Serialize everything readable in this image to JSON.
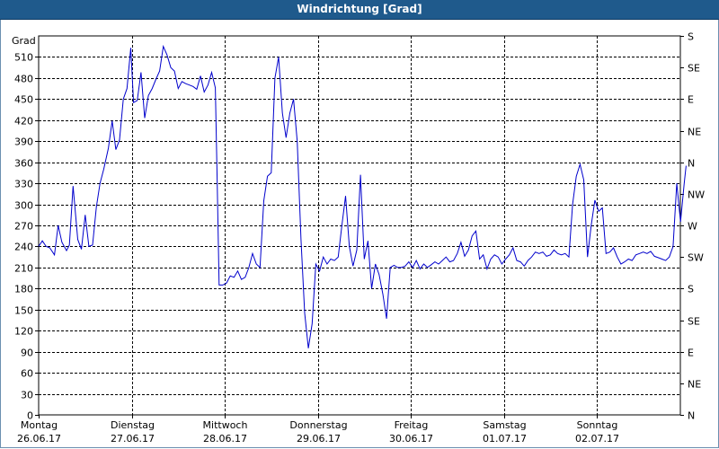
{
  "window": {
    "title": "Windrichtung [Grad]"
  },
  "chart_data": {
    "type": "line",
    "title": "Windrichtung [Grad]",
    "ylabel": "Grad",
    "ylim": [
      0,
      540
    ],
    "yticks": [
      0,
      30,
      60,
      90,
      120,
      150,
      180,
      210,
      240,
      270,
      300,
      330,
      360,
      390,
      420,
      450,
      480,
      510
    ],
    "right_ticks": [
      {
        "v": 0,
        "label": "N"
      },
      {
        "v": 45,
        "label": "NE"
      },
      {
        "v": 90,
        "label": "E"
      },
      {
        "v": 135,
        "label": "SE"
      },
      {
        "v": 180,
        "label": "S"
      },
      {
        "v": 225,
        "label": "SW"
      },
      {
        "v": 270,
        "label": "W"
      },
      {
        "v": 315,
        "label": "NW"
      },
      {
        "v": 360,
        "label": "N"
      },
      {
        "v": 405,
        "label": "NE"
      },
      {
        "v": 450,
        "label": "E"
      },
      {
        "v": 495,
        "label": "SE"
      },
      {
        "v": 540,
        "label": "S"
      }
    ],
    "xlim": [
      0,
      7
    ],
    "x_days": [
      {
        "x": 0,
        "day": "Montag",
        "date": "26.06.17"
      },
      {
        "x": 1,
        "day": "Dienstag",
        "date": "27.06.17"
      },
      {
        "x": 2,
        "day": "Mittwoch",
        "date": "28.06.17"
      },
      {
        "x": 3,
        "day": "Donnerstag",
        "date": "29.06.17"
      },
      {
        "x": 4,
        "day": "Freitag",
        "date": "30.06.17"
      },
      {
        "x": 5,
        "day": "Samstag",
        "date": "01.07.17"
      },
      {
        "x": 6,
        "day": "Sonntag",
        "date": "02.07.17"
      }
    ],
    "grid": true,
    "line_color": "#0000cc",
    "series": [
      {
        "points": [
          [
            0.0,
            240
          ],
          [
            0.04,
            248
          ],
          [
            0.08,
            240
          ],
          [
            0.12,
            238
          ],
          [
            0.17,
            228
          ],
          [
            0.21,
            270
          ],
          [
            0.25,
            246
          ],
          [
            0.3,
            234
          ],
          [
            0.33,
            242
          ],
          [
            0.37,
            326
          ],
          [
            0.42,
            250
          ],
          [
            0.46,
            236
          ],
          [
            0.5,
            285
          ],
          [
            0.54,
            240
          ],
          [
            0.58,
            242
          ],
          [
            0.62,
            296
          ],
          [
            0.66,
            330
          ],
          [
            0.7,
            350
          ],
          [
            0.75,
            380
          ],
          [
            0.79,
            419
          ],
          [
            0.83,
            378
          ],
          [
            0.87,
            392
          ],
          [
            0.91,
            450
          ],
          [
            0.95,
            465
          ],
          [
            0.99,
            523
          ],
          [
            1.02,
            445
          ],
          [
            1.06,
            448
          ],
          [
            1.1,
            488
          ],
          [
            1.14,
            423
          ],
          [
            1.18,
            455
          ],
          [
            1.22,
            465
          ],
          [
            1.26,
            478
          ],
          [
            1.3,
            490
          ],
          [
            1.34,
            525
          ],
          [
            1.38,
            513
          ],
          [
            1.42,
            495
          ],
          [
            1.46,
            490
          ],
          [
            1.5,
            465
          ],
          [
            1.54,
            475
          ],
          [
            1.58,
            472
          ],
          [
            1.62,
            470
          ],
          [
            1.66,
            468
          ],
          [
            1.7,
            464
          ],
          [
            1.74,
            483
          ],
          [
            1.78,
            460
          ],
          [
            1.82,
            470
          ],
          [
            1.86,
            488
          ],
          [
            1.9,
            466
          ],
          [
            1.92,
            330
          ],
          [
            1.94,
            185
          ],
          [
            1.98,
            185
          ],
          [
            2.02,
            188
          ],
          [
            2.06,
            198
          ],
          [
            2.1,
            196
          ],
          [
            2.14,
            205
          ],
          [
            2.18,
            193
          ],
          [
            2.22,
            196
          ],
          [
            2.26,
            210
          ],
          [
            2.3,
            230
          ],
          [
            2.34,
            215
          ],
          [
            2.38,
            210
          ],
          [
            2.42,
            305
          ],
          [
            2.46,
            340
          ],
          [
            2.5,
            345
          ],
          [
            2.54,
            480
          ],
          [
            2.58,
            510
          ],
          [
            2.62,
            430
          ],
          [
            2.66,
            395
          ],
          [
            2.7,
            430
          ],
          [
            2.74,
            450
          ],
          [
            2.78,
            390
          ],
          [
            2.82,
            250
          ],
          [
            2.86,
            145
          ],
          [
            2.9,
            95
          ],
          [
            2.94,
            130
          ],
          [
            2.98,
            215
          ],
          [
            3.02,
            205
          ],
          [
            3.06,
            225
          ],
          [
            3.1,
            215
          ],
          [
            3.14,
            222
          ],
          [
            3.18,
            220
          ],
          [
            3.22,
            225
          ],
          [
            3.26,
            270
          ],
          [
            3.3,
            312
          ],
          [
            3.34,
            240
          ],
          [
            3.38,
            212
          ],
          [
            3.42,
            235
          ],
          [
            3.46,
            342
          ],
          [
            3.5,
            222
          ],
          [
            3.54,
            248
          ],
          [
            3.58,
            180
          ],
          [
            3.62,
            215
          ],
          [
            3.66,
            200
          ],
          [
            3.7,
            172
          ],
          [
            3.74,
            137
          ],
          [
            3.78,
            210
          ],
          [
            3.82,
            213
          ],
          [
            3.86,
            210
          ],
          [
            3.9,
            210
          ],
          [
            3.94,
            212
          ],
          [
            3.98,
            218
          ],
          [
            4.02,
            210
          ],
          [
            4.06,
            220
          ],
          [
            4.1,
            208
          ],
          [
            4.14,
            215
          ],
          [
            4.18,
            210
          ],
          [
            4.22,
            214
          ],
          [
            4.26,
            218
          ],
          [
            4.3,
            215
          ],
          [
            4.34,
            220
          ],
          [
            4.38,
            225
          ],
          [
            4.42,
            218
          ],
          [
            4.46,
            220
          ],
          [
            4.5,
            230
          ],
          [
            4.54,
            246
          ],
          [
            4.58,
            226
          ],
          [
            4.62,
            235
          ],
          [
            4.66,
            255
          ],
          [
            4.7,
            262
          ],
          [
            4.74,
            222
          ],
          [
            4.78,
            228
          ],
          [
            4.82,
            208
          ],
          [
            4.86,
            222
          ],
          [
            4.9,
            228
          ],
          [
            4.94,
            225
          ],
          [
            4.98,
            215
          ],
          [
            5.02,
            222
          ],
          [
            5.06,
            228
          ],
          [
            5.1,
            238
          ],
          [
            5.14,
            220
          ],
          [
            5.18,
            218
          ],
          [
            5.22,
            212
          ],
          [
            5.26,
            220
          ],
          [
            5.3,
            225
          ],
          [
            5.34,
            232
          ],
          [
            5.38,
            230
          ],
          [
            5.42,
            232
          ],
          [
            5.46,
            226
          ],
          [
            5.5,
            228
          ],
          [
            5.54,
            235
          ],
          [
            5.58,
            230
          ],
          [
            5.62,
            228
          ],
          [
            5.66,
            230
          ],
          [
            5.7,
            225
          ],
          [
            5.74,
            300
          ],
          [
            5.78,
            340
          ],
          [
            5.82,
            357
          ],
          [
            5.86,
            335
          ],
          [
            5.9,
            225
          ],
          [
            5.94,
            270
          ],
          [
            5.98,
            306
          ],
          [
            6.02,
            290
          ],
          [
            6.06,
            295
          ],
          [
            6.1,
            230
          ],
          [
            6.14,
            232
          ],
          [
            6.18,
            238
          ],
          [
            6.22,
            225
          ],
          [
            6.26,
            215
          ],
          [
            6.3,
            218
          ],
          [
            6.34,
            222
          ],
          [
            6.38,
            220
          ],
          [
            6.42,
            228
          ],
          [
            6.46,
            230
          ],
          [
            6.5,
            232
          ],
          [
            6.54,
            230
          ],
          [
            6.58,
            233
          ],
          [
            6.62,
            226
          ],
          [
            6.66,
            224
          ],
          [
            6.7,
            222
          ],
          [
            6.74,
            220
          ],
          [
            6.78,
            225
          ],
          [
            6.82,
            240
          ],
          [
            6.86,
            330
          ],
          [
            6.9,
            275
          ],
          [
            6.94,
            330
          ],
          [
            6.96,
            355
          ]
        ]
      }
    ]
  }
}
